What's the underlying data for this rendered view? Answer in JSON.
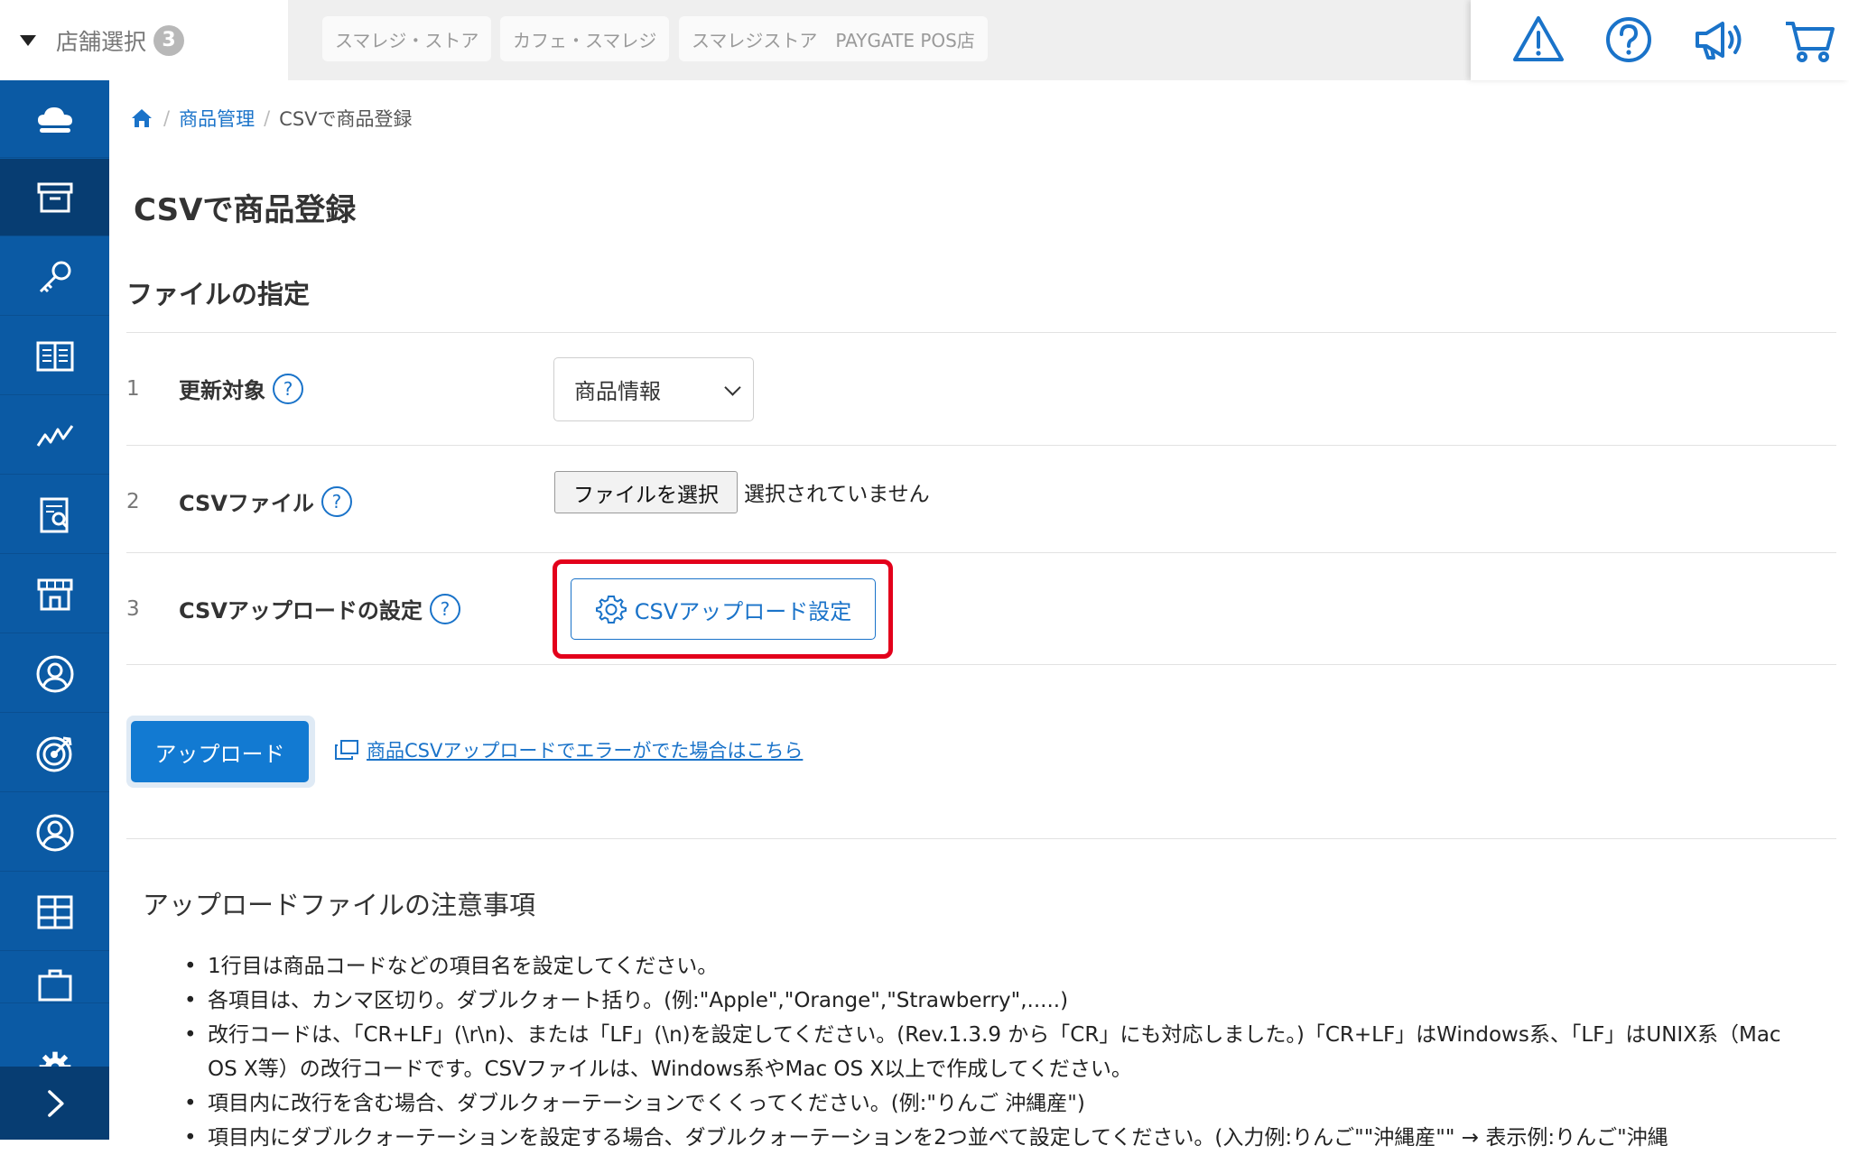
{
  "topbar": {
    "store_select_label": "店舗選択",
    "store_count": "3",
    "store_tabs": [
      "スマレジ・ストア",
      "カフェ・スマレジ",
      "スマレジストア　PAYGATE POS店"
    ],
    "icons": [
      "warning-icon",
      "help-circle-icon",
      "megaphone-icon",
      "cart-icon"
    ]
  },
  "sidebar": {
    "items": [
      "cloud-icon",
      "archive-box-icon",
      "key-icon",
      "book-icon",
      "chart-icon",
      "report-icon",
      "store-icon",
      "customer-icon",
      "target-icon",
      "staff-icon",
      "apps-icon",
      "briefcase-icon"
    ],
    "bottom": [
      "gear-icon",
      "chevron-right-icon"
    ]
  },
  "breadcrumb": {
    "home_icon": "home-icon",
    "items": [
      "商品管理",
      "CSVで商品登録"
    ]
  },
  "page": {
    "title": "CSVで商品登録",
    "section_title": "ファイルの指定"
  },
  "form": {
    "rows": [
      {
        "num": "1",
        "label": "更新対象"
      },
      {
        "num": "2",
        "label": "CSVファイル"
      },
      {
        "num": "3",
        "label": "CSVアップロードの設定"
      }
    ],
    "help_mark": "?",
    "target_select_value": "商品情報",
    "file_button_label": "ファイルを選択",
    "file_status": "選択されていません",
    "csv_setting_button": "CSVアップロード設定",
    "highlight_color": "#e3001b"
  },
  "actions": {
    "upload_button": "アップロード",
    "error_link": "商品CSVアップロードでエラーがでた場合はこちら"
  },
  "notes": {
    "title": "アップロードファイルの注意事項",
    "items": [
      "1行目は商品コードなどの項目名を設定してください。",
      "各項目は、カンマ区切り。ダブルクォート括り。(例:\"Apple\",\"Orange\",\"Strawberry\",.....)",
      "改行コードは、「CR+LF」(\\r\\n)、または「LF」(\\n)を設定してください。(Rev.1.3.9 から「CR」にも対応しました。)「CR+LF」はWindows系、「LF」はUNIX系（Mac OS X等）の改行コードです。CSVファイルは、Windows系やMac OS X以上で作成してください。",
      "項目内に改行を含む場合、ダブルクォーテーションでくくってください。(例:\"りんご 沖縄産\")",
      "項目内にダブルクォーテーションを設定する場合、ダブルクォーテーションを2つ並べて設定してください。(入力例:りんご\"\"沖縄産\"\" → 表示例:りんご\"沖縄"
    ]
  },
  "colors": {
    "sidebar": "#0b5aa4",
    "sidebar_active": "#073d72",
    "primary": "#127ad2",
    "link": "#1a73c9"
  }
}
